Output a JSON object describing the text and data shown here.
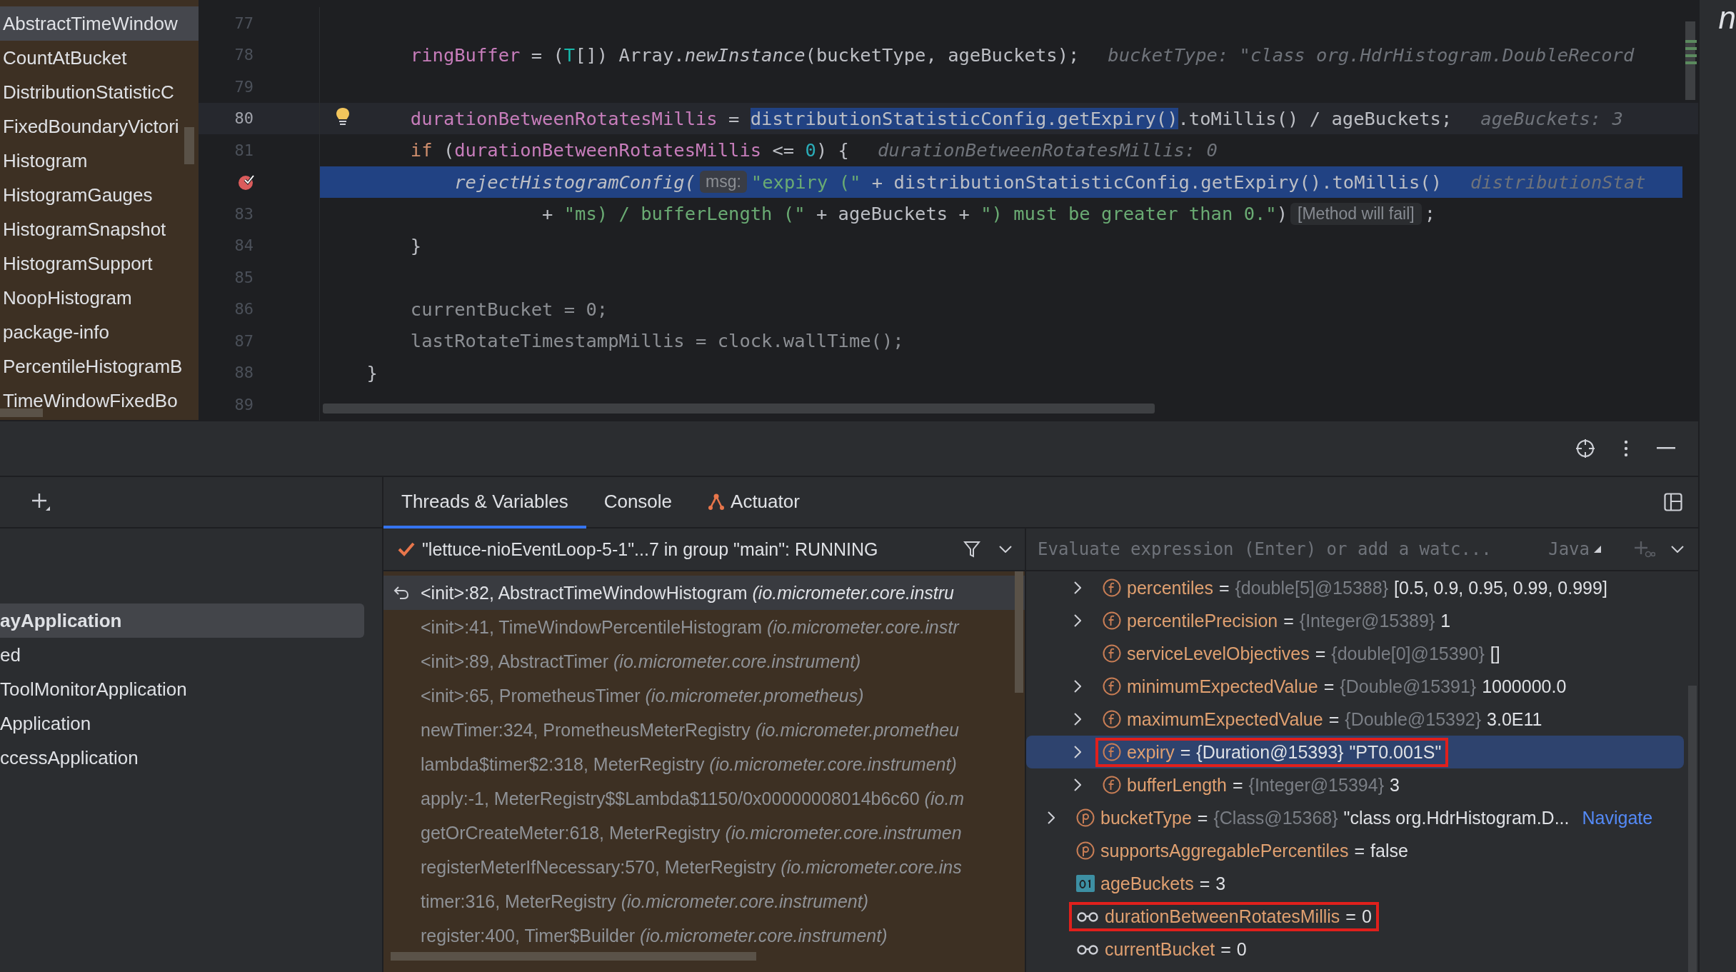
{
  "files": [
    {
      "name": "AbstractTimeWindow",
      "selected": true
    },
    {
      "name": "CountAtBucket",
      "selected": false
    },
    {
      "name": "DistributionStatisticC",
      "selected": false
    },
    {
      "name": "FixedBoundaryVictori",
      "selected": false
    },
    {
      "name": "Histogram",
      "selected": false
    },
    {
      "name": "HistogramGauges",
      "selected": false
    },
    {
      "name": "HistogramSnapshot",
      "selected": false
    },
    {
      "name": "HistogramSupport",
      "selected": false
    },
    {
      "name": "NoopHistogram",
      "selected": false
    },
    {
      "name": "package-info",
      "selected": false
    },
    {
      "name": "PercentileHistogramB",
      "selected": false
    },
    {
      "name": "TimeWindowFixedBo",
      "selected": false
    }
  ],
  "code_lines": [
    {
      "number": "77",
      "current": false,
      "selected": false,
      "breakpoint": false,
      "intention_bulb": false
    },
    {
      "number": "78",
      "current": false,
      "selected": false,
      "breakpoint": false,
      "intention_bulb": false,
      "tokens": [
        {
          "text": "        ringBuffer",
          "kind": "field"
        },
        {
          "text": " = (",
          "kind": "plain"
        },
        {
          "text": "T",
          "kind": "type"
        },
        {
          "text": "[]) Array.",
          "kind": "plain"
        },
        {
          "text": "newInstance",
          "kind": "call"
        },
        {
          "text": "(bucketType, ageBuckets);",
          "kind": "plain"
        },
        {
          "text": "bucketType: \"class org.HdrHistogram.DoubleRecord",
          "kind": "hint"
        }
      ]
    },
    {
      "number": "79",
      "current": false,
      "selected": false,
      "breakpoint": false,
      "intention_bulb": false
    },
    {
      "number": "80",
      "current": true,
      "selected": false,
      "breakpoint": false,
      "intention_bulb": true,
      "tokens": [
        {
          "text": "        durationBetweenRotatesMillis",
          "kind": "field"
        },
        {
          "text": " = ",
          "kind": "plain"
        },
        {
          "text": "distributionStatisticConfig.getExpiry()",
          "kind": "selection"
        },
        {
          "text": ".toMillis() / ageBuckets;",
          "kind": "plain"
        },
        {
          "text": "ageBuckets: 3",
          "kind": "hint"
        }
      ]
    },
    {
      "number": "81",
      "current": false,
      "selected": false,
      "breakpoint": false,
      "intention_bulb": false,
      "tokens": [
        {
          "text": "        if",
          "kind": "keyword"
        },
        {
          "text": " (",
          "kind": "plain"
        },
        {
          "text": "durationBetweenRotatesMillis",
          "kind": "field"
        },
        {
          "text": " <= ",
          "kind": "plain"
        },
        {
          "text": "0",
          "kind": "number"
        },
        {
          "text": ") {",
          "kind": "plain"
        },
        {
          "text": "durationBetweenRotatesMillis: 0",
          "kind": "hint"
        }
      ]
    },
    {
      "current": false,
      "selected": true,
      "breakpoint": true,
      "intention_bulb": false,
      "tokens": [
        {
          "text": "            rejectHistogramConfig(",
          "kind": "call"
        },
        {
          "text": "msg:",
          "kind": "param"
        },
        {
          "text": "\"expiry (\"",
          "kind": "string"
        },
        {
          "text": " + distributionStatisticConfig.getExpiry().toMillis()",
          "kind": "plain"
        },
        {
          "text": "distributionStat",
          "kind": "hint"
        }
      ]
    },
    {
      "number": "83",
      "current": false,
      "selected": false,
      "breakpoint": false,
      "intention_bulb": false,
      "tokens": [
        {
          "text": "                    + ",
          "kind": "plain"
        },
        {
          "text": "\"ms) / bufferLength (\"",
          "kind": "string"
        },
        {
          "text": " + ageBuckets + ",
          "kind": "plain"
        },
        {
          "text": "\") must be greater than 0.\"",
          "kind": "string"
        },
        {
          "text": ")",
          "kind": "plain"
        },
        {
          "text": "[Method will fail]",
          "kind": "fail"
        },
        {
          "text": ";",
          "kind": "plain"
        }
      ]
    },
    {
      "number": "84",
      "current": false,
      "selected": false,
      "breakpoint": false,
      "intention_bulb": false,
      "tokens": [
        {
          "text": "        }",
          "kind": "plain"
        }
      ]
    },
    {
      "number": "85",
      "current": false,
      "selected": false,
      "breakpoint": false,
      "intention_bulb": false
    },
    {
      "number": "86",
      "current": false,
      "selected": false,
      "breakpoint": false,
      "intention_bulb": false,
      "tokens": [
        {
          "text": "        currentBucket = 0;",
          "kind": "dim"
        }
      ]
    },
    {
      "number": "87",
      "current": false,
      "selected": false,
      "breakpoint": false,
      "intention_bulb": false,
      "tokens": [
        {
          "text": "        lastRotateTimestampMillis = clock.wallTime();",
          "kind": "dim"
        }
      ]
    },
    {
      "number": "88",
      "current": false,
      "selected": false,
      "breakpoint": false,
      "intention_bulb": false,
      "tokens": [
        {
          "text": "    }",
          "kind": "plain"
        }
      ]
    },
    {
      "number": "89",
      "current": false,
      "selected": false,
      "breakpoint": false,
      "intention_bulb": false
    }
  ],
  "edge_text": "n",
  "apps": [
    {
      "name": "ayApplication",
      "selected": true
    },
    {
      "name": "ed",
      "selected": false
    },
    {
      "name": "ToolMonitorApplication",
      "selected": false
    },
    {
      "name": "Application",
      "selected": false
    },
    {
      "name": "ccessApplication",
      "selected": false
    }
  ],
  "tabs": [
    {
      "label": "Threads & Variables",
      "selected": true,
      "kind": "builtin"
    },
    {
      "label": "Console",
      "selected": false,
      "kind": "builtin"
    },
    {
      "label": "Actuator",
      "selected": false,
      "kind": "plugin"
    }
  ],
  "thread": {
    "label": "\"lettuce-nioEventLoop-5-1\"...7 in group \"main\": RUNNING"
  },
  "frames": [
    {
      "method": "<init>:82, AbstractTimeWindowHistogram",
      "package": "(io.micrometer.core.instru",
      "selected": true
    },
    {
      "method": "<init>:41, TimeWindowPercentileHistogram",
      "package": "(io.micrometer.core.instr",
      "selected": false
    },
    {
      "method": "<init>:89, AbstractTimer",
      "package": "(io.micrometer.core.instrument)",
      "selected": false
    },
    {
      "method": "<init>:65, PrometheusTimer",
      "package": "(io.micrometer.prometheus)",
      "selected": false
    },
    {
      "method": "newTimer:324, PrometheusMeterRegistry",
      "package": "(io.micrometer.prometheu",
      "selected": false
    },
    {
      "method": "lambda$timer$2:318, MeterRegistry",
      "package": "(io.micrometer.core.instrument)",
      "selected": false
    },
    {
      "method": "apply:-1, MeterRegistry$$Lambda$1150/0x00000008014b6c60",
      "package": "(io.m",
      "selected": false
    },
    {
      "method": "getOrCreateMeter:618, MeterRegistry",
      "package": "(io.micrometer.core.instrumen",
      "selected": false
    },
    {
      "method": "registerMeterIfNecessary:570, MeterRegistry",
      "package": "(io.micrometer.core.ins",
      "selected": false
    },
    {
      "method": "timer:316, MeterRegistry",
      "package": "(io.micrometer.core.instrument)",
      "selected": false
    },
    {
      "method": "register:400, Timer$Builder",
      "package": "(io.micrometer.core.instrument)",
      "selected": false
    }
  ],
  "evaluate": {
    "placeholder": "Evaluate expression (Enter) or add a watc...",
    "language": "Java"
  },
  "variables": [
    {
      "children": [
        {
          "name": "percentiles",
          "operator": "=",
          "type_ref": "{double[5]@15388}",
          "value": "[0.5, 0.9, 0.95, 0.99, 0.999]",
          "kind": "field",
          "expandable": true,
          "selected": false,
          "annotated": false
        },
        {
          "name": "percentilePrecision",
          "operator": "=",
          "type_ref": "{Integer@15389}",
          "value": "1",
          "kind": "field",
          "expandable": true,
          "selected": false,
          "annotated": false
        },
        {
          "name": "serviceLevelObjectives",
          "operator": "=",
          "type_ref": "{double[0]@15390}",
          "value": "[]",
          "kind": "field",
          "expandable": false,
          "selected": false,
          "annotated": false
        },
        {
          "name": "minimumExpectedValue",
          "operator": "=",
          "type_ref": "{Double@15391}",
          "value": "1000000.0",
          "kind": "field",
          "expandable": true,
          "selected": false,
          "annotated": false
        },
        {
          "name": "maximumExpectedValue",
          "operator": "=",
          "type_ref": "{Double@15392}",
          "value": "3.0E11",
          "kind": "field",
          "expandable": true,
          "selected": false,
          "annotated": false
        },
        {
          "name": "expiry",
          "operator": "=",
          "type_ref": "{Duration@15393}",
          "value": "\"PT0.001S\"",
          "kind": "field",
          "expandable": true,
          "selected": true,
          "annotated": true
        },
        {
          "name": "bufferLength",
          "operator": "=",
          "type_ref": "{Integer@15394}",
          "value": "3",
          "kind": "field",
          "expandable": true,
          "selected": false,
          "annotated": false
        }
      ]
    },
    {
      "name": "bucketType",
      "operator": "=",
      "type_ref": "{Class@15368}",
      "value": "\"class org.HdrHistogram.D...",
      "link": "Navigate",
      "kind": "property",
      "expandable": true,
      "selected": false,
      "annotated": false
    },
    {
      "name": "supportsAggregablePercentiles",
      "operator": "=",
      "value": "false",
      "kind": "property",
      "expandable": false,
      "selected": false,
      "annotated": false
    },
    {
      "name": "ageBuckets",
      "operator": "=",
      "value": "3",
      "kind": "primitive",
      "expandable": false,
      "selected": false,
      "annotated": false
    },
    {
      "name": "durationBetweenRotatesMillis",
      "operator": "=",
      "value": "0",
      "kind": "watch",
      "expandable": false,
      "selected": false,
      "annotated": true
    },
    {
      "name": "currentBucket",
      "operator": "=",
      "value": "0",
      "kind": "watch",
      "expandable": false,
      "selected": false,
      "annotated": false
    }
  ]
}
